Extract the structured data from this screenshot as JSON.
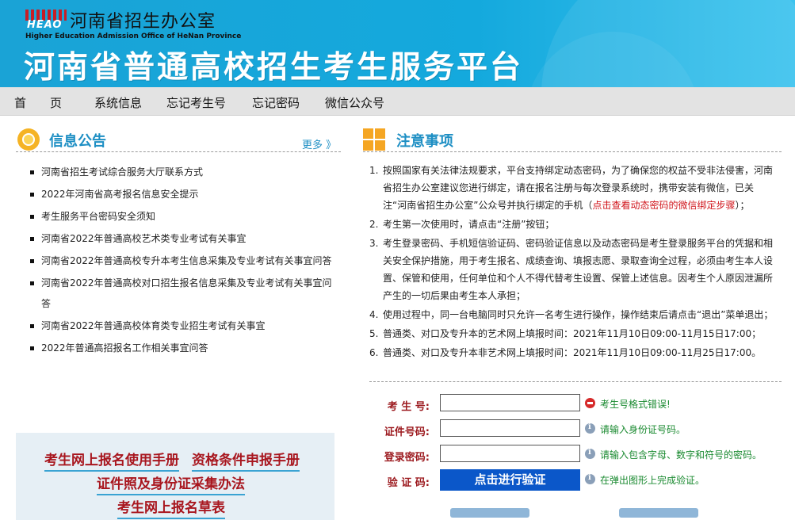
{
  "header": {
    "logo_text": "HEAO",
    "org_name": "河南省招生办公室",
    "org_name_en": "Higher Education Admission Office of HeNan Province",
    "platform_title": "河南省普通高校招生考生服务平台"
  },
  "nav": {
    "items": [
      "首　　页",
      "系统信息",
      "忘记考生号",
      "忘记密码",
      "微信公众号"
    ]
  },
  "info": {
    "title": "信息公告",
    "more": "更多 》",
    "items": [
      "河南省招生考试综合服务大厅联系方式",
      "2022年河南省高考报名信息安全提示",
      "考生服务平台密码安全须知",
      "河南省2022年普通高校艺术类专业考试有关事宜",
      "河南省2022年普通高校专升本考生信息采集及专业考试有关事宜问答",
      "河南省2022年普通高校对口招生报名信息采集及专业考试有关事宜问答",
      "河南省2022年普通高校体育类专业招生考试有关事宜",
      "2022年普通高招报名工作相关事宜问答"
    ]
  },
  "manuals": {
    "link1": "考生网上报名使用手册",
    "link2": "资格条件申报手册",
    "link3": "证件照及身份证采集办法",
    "link4": "考生网上报名草表"
  },
  "notes": {
    "title": "注意事项",
    "items": [
      {
        "num": "1.",
        "text": "按照国家有关法律法规要求，平台支持绑定动态密码，为了确保您的权益不受非法侵害，河南省招生办公室建议您进行绑定，请在报名注册与每次登录系统时，携带安装有微信，已关注“河南省招生办公室”公众号并执行绑定的手机（",
        "link": "点击查看动态密码的微信绑定步骤",
        "after": "）；"
      },
      {
        "num": "2.",
        "text": "考生第一次使用时，请点击“注册”按钮；",
        "link": "",
        "after": ""
      },
      {
        "num": "3.",
        "text": "考生登录密码、手机短信验证码、密码验证信息以及动态密码是考生登录服务平台的凭据和相关安全保护措施，用于考生报名、成绩查询、填报志愿、录取查询全过程，必须由考生本人设置、保管和使用，任何单位和个人不得代替考生设置、保管上述信息。因考生个人原因泄漏所产生的一切后果由考生本人承担；",
        "link": "",
        "after": ""
      },
      {
        "num": "4.",
        "text": "使用过程中，同一台电脑同时只允许一名考生进行操作，操作结束后请点击“退出”菜单退出；",
        "link": "",
        "after": ""
      },
      {
        "num": "5.",
        "text": "普通类、对口及专升本的艺术网上填报时间：2021年11月10日09:00-11月15日17:00；",
        "link": "",
        "after": ""
      },
      {
        "num": "6.",
        "text": "普通类、对口及专升本非艺术网上填报时间：2021年11月10日09:00-11月25日17:00。",
        "link": "",
        "after": ""
      }
    ]
  },
  "form": {
    "exam_no_label": "考 生 号:",
    "exam_no_value": "",
    "exam_no_hint": "考生号格式错误!",
    "id_label": "证件号码:",
    "id_value": "",
    "id_hint": "请输入身份证号码。",
    "pwd_label": "登录密码:",
    "pwd_value": "",
    "pwd_hint": "请输入包含字母、数字和符号的密码。",
    "verify_label": "验 证 码:",
    "verify_button": "点击进行验证",
    "verify_hint": "在弹出图形上完成验证。"
  },
  "colors": {
    "header_blue": "#1aa3d6",
    "title_blue": "#1e8fc4",
    "link_red": "#a8161e",
    "hint_green": "#1a8a30",
    "button_blue": "#0b57c9"
  }
}
